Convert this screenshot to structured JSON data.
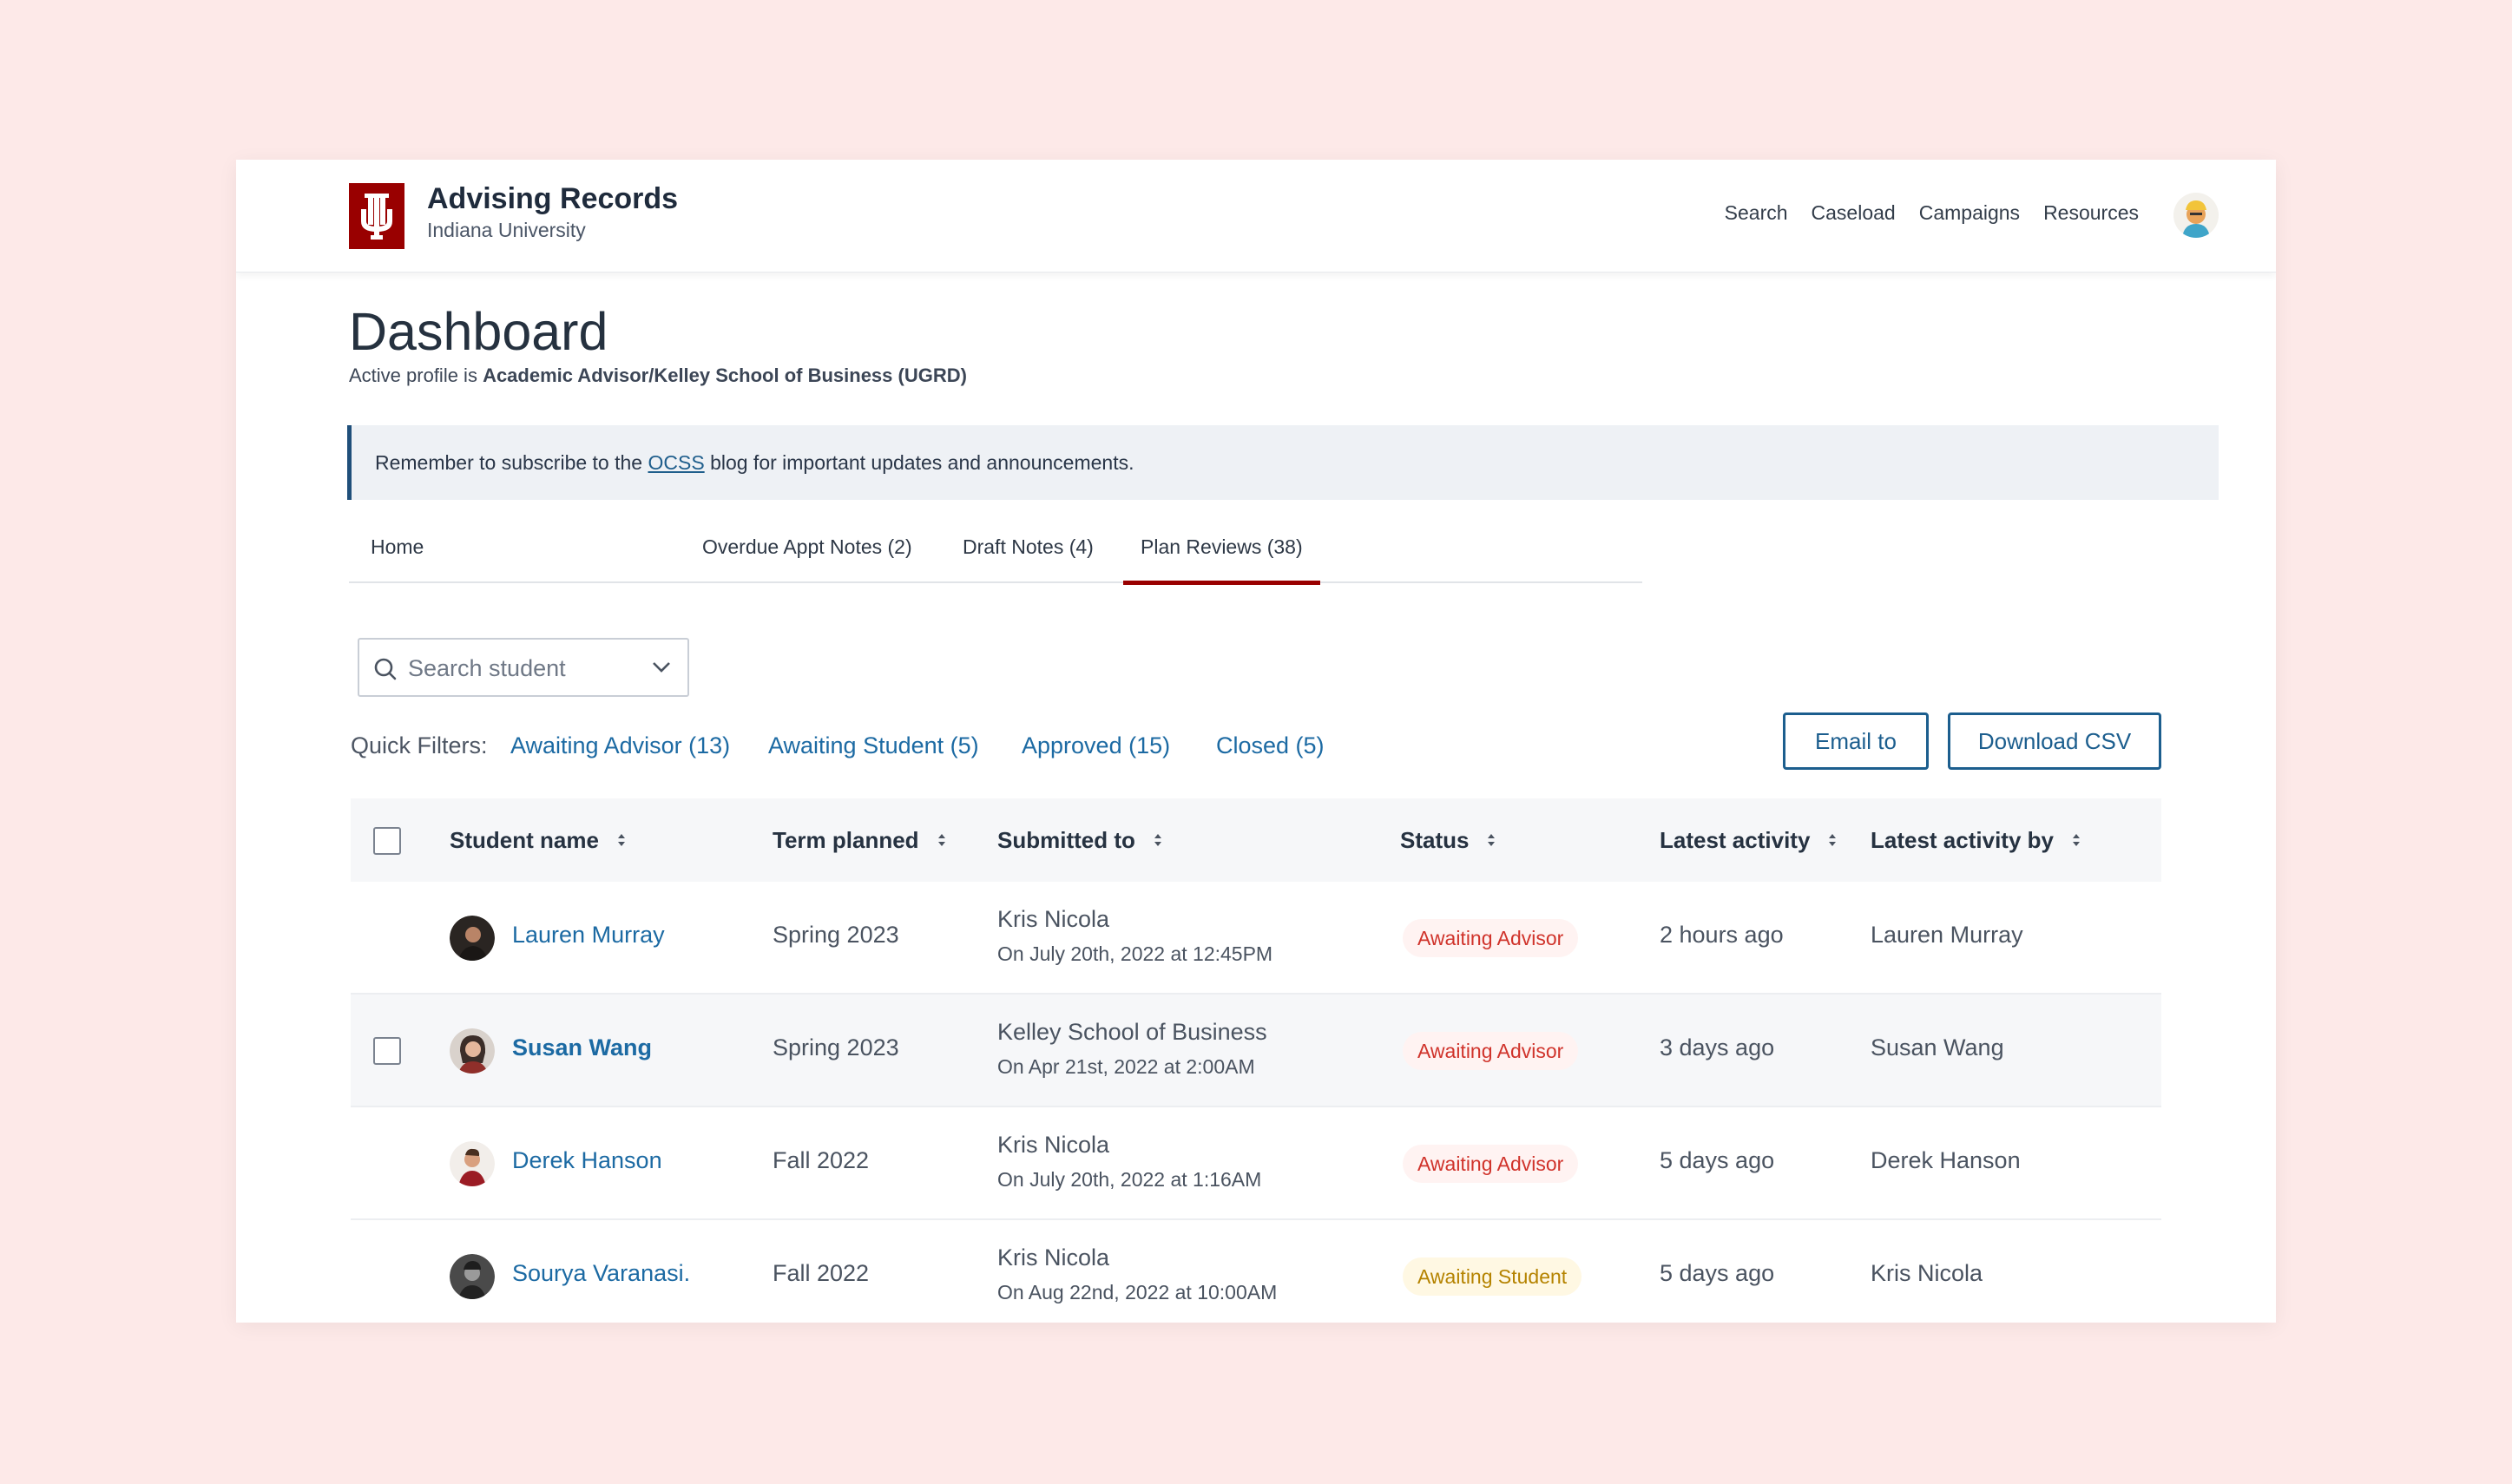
{
  "header": {
    "app_title": "Advising Records",
    "app_subtitle": "Indiana University",
    "nav": [
      "Search",
      "Caseload",
      "Campaigns",
      "Resources"
    ],
    "brand_color": "#990000"
  },
  "page": {
    "title": "Dashboard",
    "profile_prefix": "Active profile is ",
    "profile_value": "Academic Advisor/Kelley School of Business (UGRD)"
  },
  "notice": {
    "before": "Remember to subscribe to the ",
    "link": "OCSS",
    "after": " blog for important updates and announcements."
  },
  "tabs": [
    "Home",
    "Overdue Appt Notes (2)",
    "Draft Notes (4)",
    "Plan Reviews (38)"
  ],
  "active_tab": "Plan Reviews (38)",
  "search": {
    "placeholder": "Search student"
  },
  "filters": {
    "label": "Quick Filters:",
    "items": [
      "Awaiting Advisor (13)",
      "Awaiting Student (5)",
      "Approved (15)",
      "Closed (5)"
    ]
  },
  "actions": {
    "email": "Email to",
    "download": "Download CSV"
  },
  "table": {
    "columns": [
      "Student name",
      "Term planned",
      "Submitted to",
      "Status",
      "Latest activity",
      "Latest activity by"
    ],
    "rows": [
      {
        "name": "Lauren Murray",
        "term": "Spring 2023",
        "submitted_to": "Kris Nicola",
        "submitted_on": "On July 20th, 2022 at 12:45PM",
        "status": "Awaiting Advisor",
        "activity": "2 hours ago",
        "activity_by": "Lauren Murray"
      },
      {
        "name": "Susan Wang",
        "term": "Spring 2023",
        "submitted_to": "Kelley School of Business",
        "submitted_on": "On Apr 21st, 2022 at 2:00AM",
        "status": "Awaiting Advisor",
        "activity": "3 days ago",
        "activity_by": "Susan Wang"
      },
      {
        "name": "Derek Hanson",
        "term": "Fall 2022",
        "submitted_to": "Kris Nicola",
        "submitted_on": "On July 20th, 2022 at 1:16AM",
        "status": "Awaiting Advisor",
        "activity": "5 days ago",
        "activity_by": "Derek Hanson"
      },
      {
        "name": "Sourya Varanasi.",
        "term": "Fall 2022",
        "submitted_to": "Kris Nicola",
        "submitted_on": "On Aug 22nd, 2022 at 10:00AM",
        "status": "Awaiting Student",
        "activity": "5 days ago",
        "activity_by": "Kris Nicola"
      }
    ]
  },
  "colors": {
    "link": "#1c6aa3",
    "awaiting_advisor": "#d0332b",
    "awaiting_student": "#b58300"
  }
}
